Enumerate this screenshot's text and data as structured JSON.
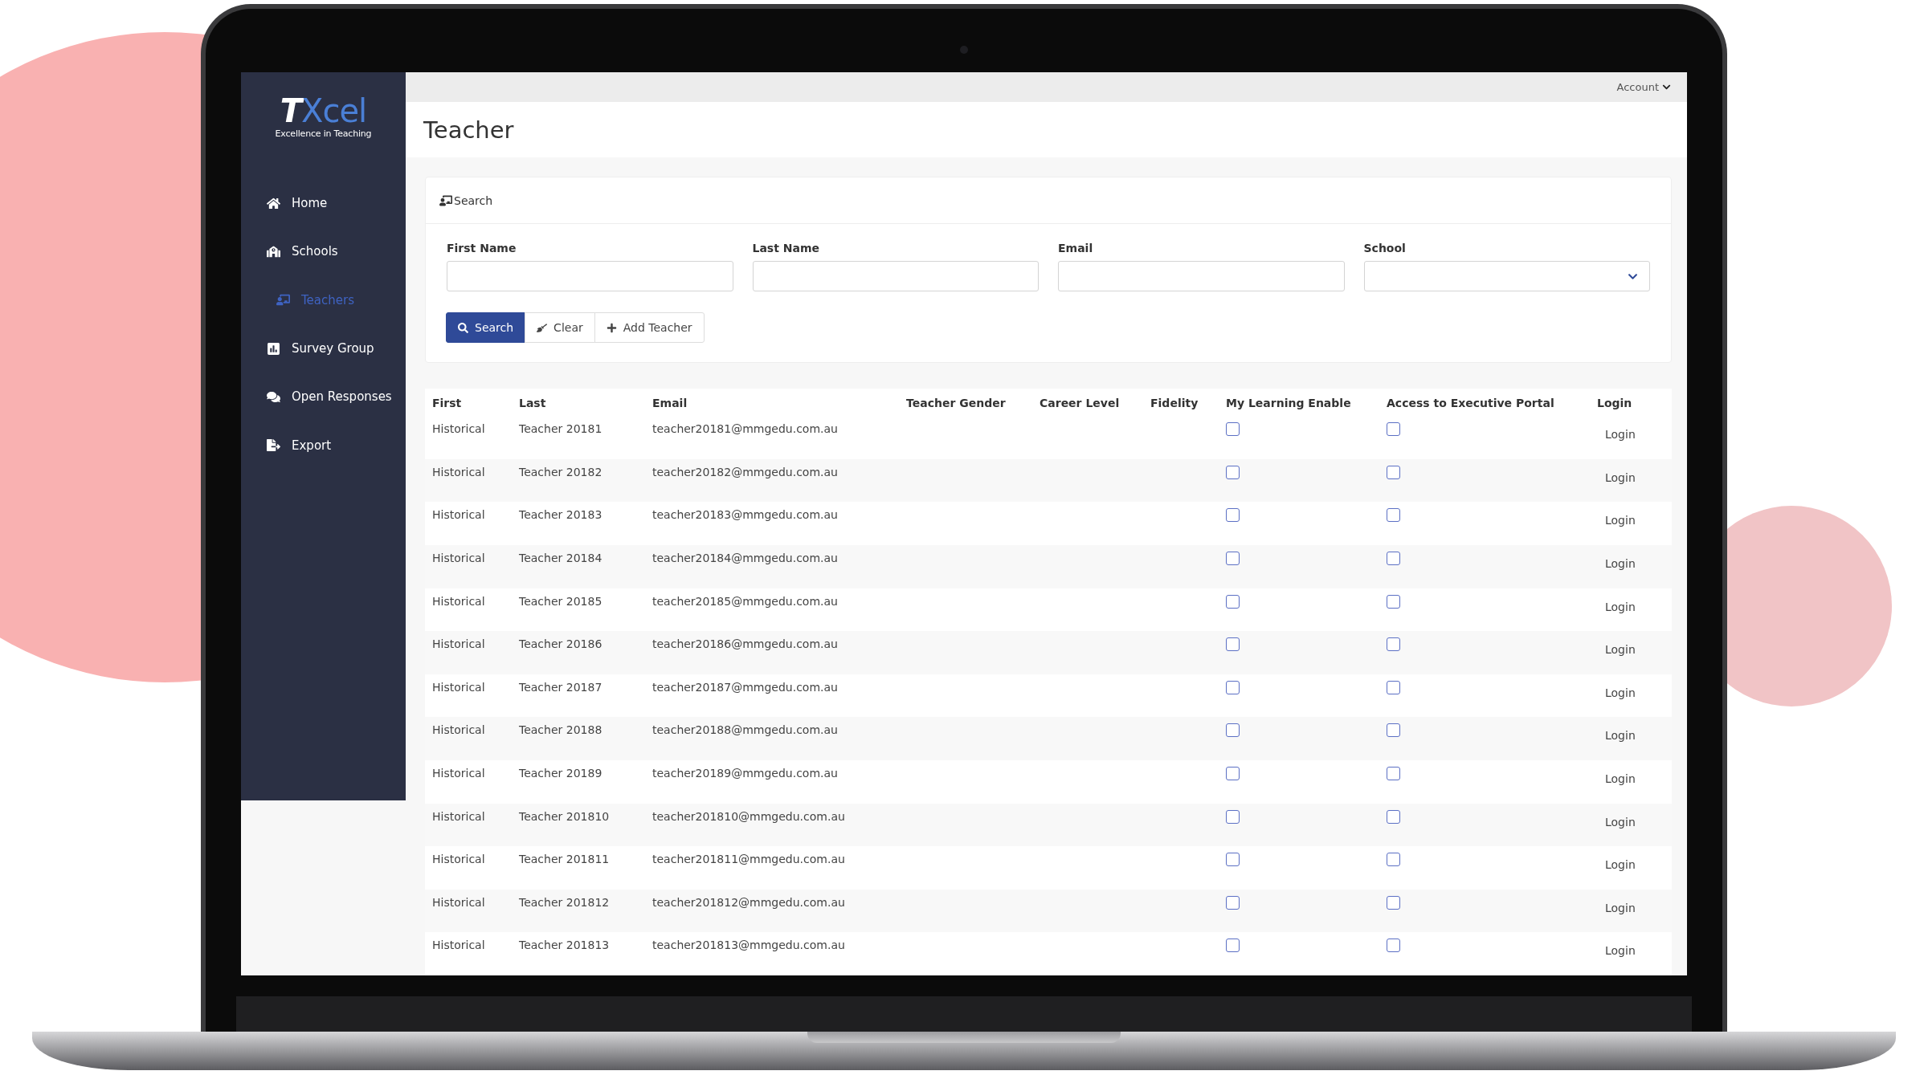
{
  "topbar": {
    "account": "Account"
  },
  "logo": {
    "mark": "T",
    "name": "Xcel",
    "tagline": "Excellence in Teaching"
  },
  "sidebar": {
    "items": [
      {
        "kind": "home",
        "label": "Home",
        "selected": false
      },
      {
        "kind": "schools",
        "label": "Schools",
        "selected": false
      },
      {
        "kind": "teachers",
        "label": "Teachers",
        "selected": true
      },
      {
        "kind": "survey",
        "label": "Survey Group",
        "selected": false
      },
      {
        "kind": "responses",
        "label": "Open Responses",
        "selected": false
      },
      {
        "kind": "export",
        "label": "Export",
        "selected": false
      }
    ]
  },
  "page_title": "Teacher",
  "search_panel": {
    "title": "Search",
    "fields": [
      {
        "kind": "text",
        "label": "First Name"
      },
      {
        "kind": "text",
        "label": "Last Name"
      },
      {
        "kind": "text",
        "label": "Email"
      },
      {
        "kind": "select",
        "label": "School"
      }
    ],
    "buttons": [
      {
        "kind": "search",
        "label": "Search"
      },
      {
        "kind": "clear",
        "label": "Clear"
      },
      {
        "kind": "add",
        "label": "Add Teacher"
      }
    ]
  },
  "table": {
    "columns": [
      "First",
      "Last",
      "Email",
      "Teacher Gender",
      "Career Level",
      "Fidelity",
      "My Learning Enable",
      "Access to Executive Portal",
      "Login"
    ],
    "rows": [
      {
        "first": "Historical",
        "last": "Teacher 20181",
        "email": "teacher20181@mmgedu.com.au",
        "my_learning": false,
        "exec_portal": false,
        "login": "Login"
      },
      {
        "first": "Historical",
        "last": "Teacher 20182",
        "email": "teacher20182@mmgedu.com.au",
        "my_learning": false,
        "exec_portal": false,
        "login": "Login"
      },
      {
        "first": "Historical",
        "last": "Teacher 20183",
        "email": "teacher20183@mmgedu.com.au",
        "my_learning": false,
        "exec_portal": false,
        "login": "Login"
      },
      {
        "first": "Historical",
        "last": "Teacher 20184",
        "email": "teacher20184@mmgedu.com.au",
        "my_learning": false,
        "exec_portal": false,
        "login": "Login"
      },
      {
        "first": "Historical",
        "last": "Teacher 20185",
        "email": "teacher20185@mmgedu.com.au",
        "my_learning": false,
        "exec_portal": false,
        "login": "Login"
      },
      {
        "first": "Historical",
        "last": "Teacher 20186",
        "email": "teacher20186@mmgedu.com.au",
        "my_learning": false,
        "exec_portal": false,
        "login": "Login"
      },
      {
        "first": "Historical",
        "last": "Teacher 20187",
        "email": "teacher20187@mmgedu.com.au",
        "my_learning": false,
        "exec_portal": false,
        "login": "Login"
      },
      {
        "first": "Historical",
        "last": "Teacher 20188",
        "email": "teacher20188@mmgedu.com.au",
        "my_learning": false,
        "exec_portal": false,
        "login": "Login"
      },
      {
        "first": "Historical",
        "last": "Teacher 20189",
        "email": "teacher20189@mmgedu.com.au",
        "my_learning": false,
        "exec_portal": false,
        "login": "Login"
      },
      {
        "first": "Historical",
        "last": "Teacher 201810",
        "email": "teacher201810@mmgedu.com.au",
        "my_learning": false,
        "exec_portal": false,
        "login": "Login"
      },
      {
        "first": "Historical",
        "last": "Teacher 201811",
        "email": "teacher201811@mmgedu.com.au",
        "my_learning": false,
        "exec_portal": false,
        "login": "Login"
      },
      {
        "first": "Historical",
        "last": "Teacher 201812",
        "email": "teacher201812@mmgedu.com.au",
        "my_learning": false,
        "exec_portal": false,
        "login": "Login"
      },
      {
        "first": "Historical",
        "last": "Teacher 201813",
        "email": "teacher201813@mmgedu.com.au",
        "my_learning": false,
        "exec_portal": false,
        "login": "Login"
      }
    ]
  }
}
